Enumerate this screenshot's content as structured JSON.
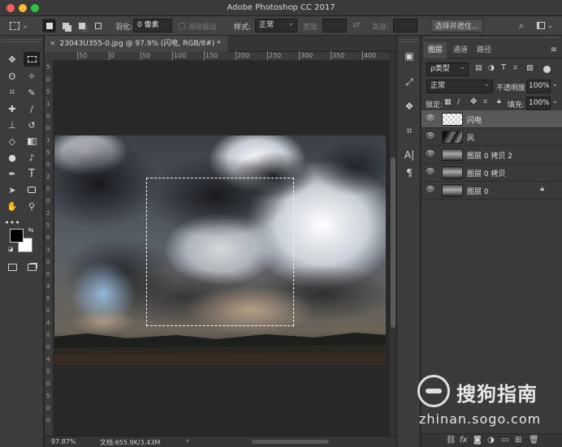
{
  "window": {
    "title": "Adobe Photoshop CC 2017",
    "buttons": {
      "close_color": "#fc5f57",
      "minimize_color": "#fdbc2e",
      "maximize_color": "#28c840"
    }
  },
  "options_bar": {
    "feather_label": "羽化:",
    "feather_value": "0 像素",
    "antialias_label": "消除锯齿",
    "style_label": "样式:",
    "style_value": "正常",
    "width_label": "宽度:",
    "height_label": "高度:",
    "select_mask_button": "选择并遮住..."
  },
  "document": {
    "tab_title": "23043U355-0.jpg @ 97.9% (闪电, RGB/8#) *",
    "close_glyph": "×"
  },
  "rulers": {
    "top_labels": [
      "50",
      "0",
      "50",
      "100",
      "150",
      "200",
      "250",
      "300",
      "350",
      "400",
      "450",
      "500",
      "550"
    ],
    "left_labels": [
      "5",
      "0",
      "5",
      "1",
      "0",
      "0",
      "1",
      "5",
      "0",
      "2",
      "0",
      "0",
      "2",
      "5",
      "0",
      "3",
      "0",
      "0",
      "3",
      "5",
      "0",
      "4",
      "0",
      "0",
      "4",
      "5",
      "0",
      "5",
      "0",
      "0"
    ]
  },
  "status_bar": {
    "zoom": "97.87%",
    "doc_info": "文档:655.9K/3.43M",
    "arrow": "›"
  },
  "layers_panel": {
    "tabs": [
      "图层",
      "通道",
      "路径"
    ],
    "filter_kind": "ρ类型",
    "blend_mode": "正常",
    "opacity_label": "不透明度:",
    "opacity_value": "100%",
    "lock_label": "锁定:",
    "fill_label": "填充:",
    "fill_value": "100%",
    "layers": [
      {
        "name": "闪电",
        "selected": true,
        "locked": false
      },
      {
        "name": "风",
        "selected": false,
        "locked": false
      },
      {
        "name": "图层 0 拷贝 2",
        "selected": false,
        "locked": false
      },
      {
        "name": "图层 0 拷贝",
        "selected": false,
        "locked": false
      },
      {
        "name": "图层 0",
        "selected": false,
        "locked": true
      }
    ]
  },
  "watermark": {
    "brand": "搜狗指南",
    "url": "zhinan.sogo.com"
  }
}
